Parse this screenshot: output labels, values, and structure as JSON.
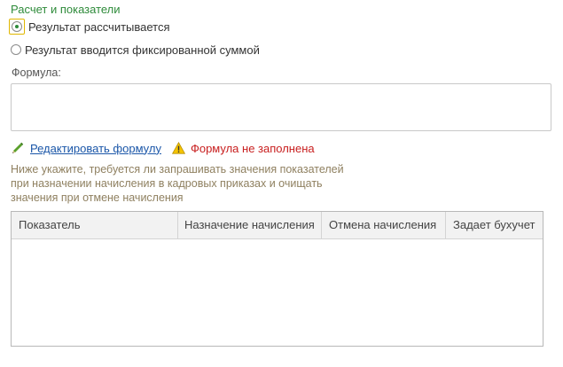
{
  "section": {
    "title": "Расчет и показатели"
  },
  "calc_mode": {
    "options": [
      {
        "label": "Результат рассчитывается",
        "selected": true
      },
      {
        "label": "Результат вводится фиксированной суммой",
        "selected": false
      }
    ]
  },
  "formula": {
    "label": "Формула:",
    "value": ""
  },
  "edit": {
    "link_label": "Редактировать формулу",
    "warning_text": "Формула не заполнена",
    "warning_color": "#c81e1e"
  },
  "hint": {
    "lines": [
      "Ниже укажите, требуется ли запрашивать значения показателей",
      "при назначении начисления в кадровых приказах и очищать",
      "значения при отмене начисления"
    ]
  },
  "indicators_table": {
    "columns": [
      "Показатель",
      "Назначение начисления",
      "Отмена начисления",
      "Задает бухучет"
    ],
    "rows": []
  },
  "colors": {
    "accent": "#2e8b3a",
    "link": "#1a56a8",
    "hint": "#8f8060",
    "focus": "#e0b700"
  }
}
